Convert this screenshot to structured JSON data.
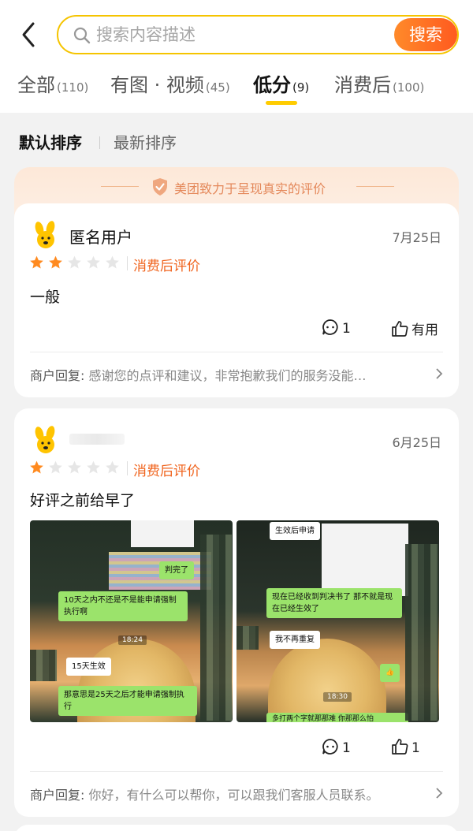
{
  "search": {
    "placeholder": "搜索内容描述",
    "button_label": "搜索"
  },
  "tabs": [
    {
      "label": "全部",
      "count": "(110)"
    },
    {
      "label": "有图 · 视频",
      "count": "(45)"
    },
    {
      "label": "低分",
      "count": "(9)",
      "active": true
    },
    {
      "label": "消费后",
      "count": "(100)"
    }
  ],
  "sort": {
    "default": "默认排序",
    "latest": "最新排序"
  },
  "notice": {
    "text": "美团致力于呈现真实的评价"
  },
  "reviews": [
    {
      "user": "匿名用户",
      "date": "7月25日",
      "rating": 2,
      "tag": "消费后评价",
      "content": "一般",
      "comment_count": "1",
      "useful_label": "有用",
      "reply_label": "商户回复:",
      "reply_text": " 感谢您的点评和建议，非常抱歉我们的服务没能…"
    },
    {
      "user": "",
      "date": "6月25日",
      "rating": 1,
      "tag": "消费后评价",
      "content": "好评之前给早了",
      "comment_count": "1",
      "useful_count": "1",
      "reply_label": "商户回复:",
      "reply_text": " 你好，有什么可以帮你，可以跟我们客服人员联系。",
      "photos": [
        {
          "bubbles": [
            "判完了",
            "10天之内不还是不是能申请强制执行啊",
            "15天生效",
            "那意思是25天之后才能申请强制执行"
          ],
          "time": "18:24"
        },
        {
          "bubbles": [
            "生效后申请",
            "现在已经收到判决书了 那不就是现在已经生效了",
            "我不再重复",
            "多打两个字就那那难 你那那么怕"
          ],
          "time": "18:30"
        }
      ]
    }
  ],
  "colors": {
    "accent": "#ffcc00",
    "brand_orange": "#f0641e",
    "star": "#ff8a1f",
    "star_empty": "#e6e6e6"
  }
}
